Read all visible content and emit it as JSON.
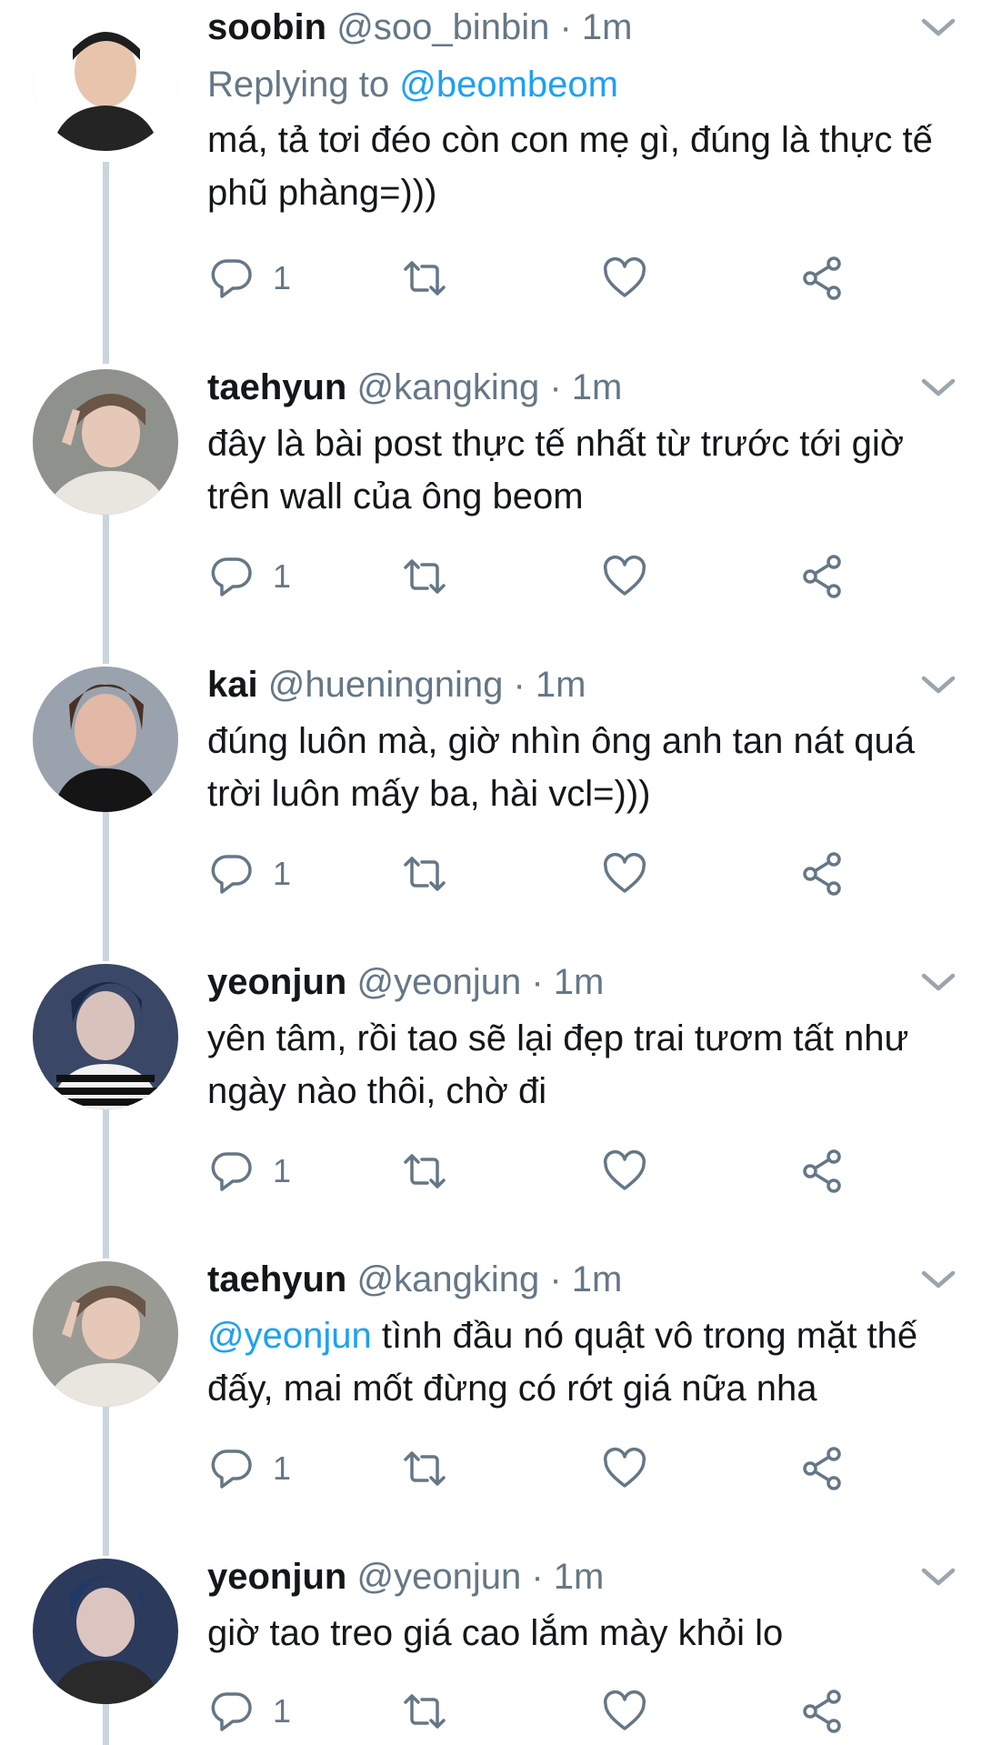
{
  "reply_to": {
    "prefix": "Replying to",
    "mention": "@beombeom"
  },
  "tweets": [
    {
      "name": "soobin",
      "handle": "@soo_binbin",
      "dot": "·",
      "time": "1m",
      "text": "má, tả tơi đéo còn con mẹ gì, đúng là thực tế phũ phàng=)))",
      "mention": "",
      "reply_count": "1",
      "avatar_bg": "#e9d6cc"
    },
    {
      "name": "taehyun",
      "handle": "@kangking",
      "dot": "·",
      "time": "1m",
      "text": "đây là bài post thực tế nhất từ trước tới giờ trên wall của ông beom",
      "mention": "",
      "reply_count": "1",
      "avatar_bg": "#9a9a94"
    },
    {
      "name": "kai",
      "handle": "@hueningning",
      "dot": "·",
      "time": "1m",
      "text": "đúng luôn mà, giờ nhìn ông anh tan nát quá trời luôn mấy ba, hài vcl=)))",
      "mention": "",
      "reply_count": "1",
      "avatar_bg": "#8e9aa4"
    },
    {
      "name": "yeonjun",
      "handle": "@yeonjun",
      "dot": "·",
      "time": "1m",
      "text": "yên tâm, rồi tao sẽ lại đẹp trai tươm tất như ngày nào thôi, chờ đi",
      "mention": "",
      "reply_count": "1",
      "avatar_bg": "#3b4a6a"
    },
    {
      "name": "taehyun",
      "handle": "@kangking",
      "dot": "·",
      "time": "1m",
      "text": " tình đầu nó quật vô trong mặt thế đấy, mai mốt đừng có rớt giá nữa nha",
      "mention": "@yeonjun",
      "reply_count": "1",
      "avatar_bg": "#9a9a94"
    },
    {
      "name": "yeonjun",
      "handle": "@yeonjun",
      "dot": "·",
      "time": "1m",
      "text": "giờ tao treo giá cao lắm mày khỏi lo",
      "mention": "",
      "reply_count": "1",
      "avatar_bg": "#2c3a5c"
    }
  ],
  "icons": {
    "reply": "reply-icon",
    "retweet": "retweet-icon",
    "like": "heart-icon",
    "share": "share-icon",
    "more": "chevron-down-icon"
  },
  "colors": {
    "accent": "#1da1f2",
    "muted": "#657786",
    "thread_line": "#c9d5df"
  }
}
